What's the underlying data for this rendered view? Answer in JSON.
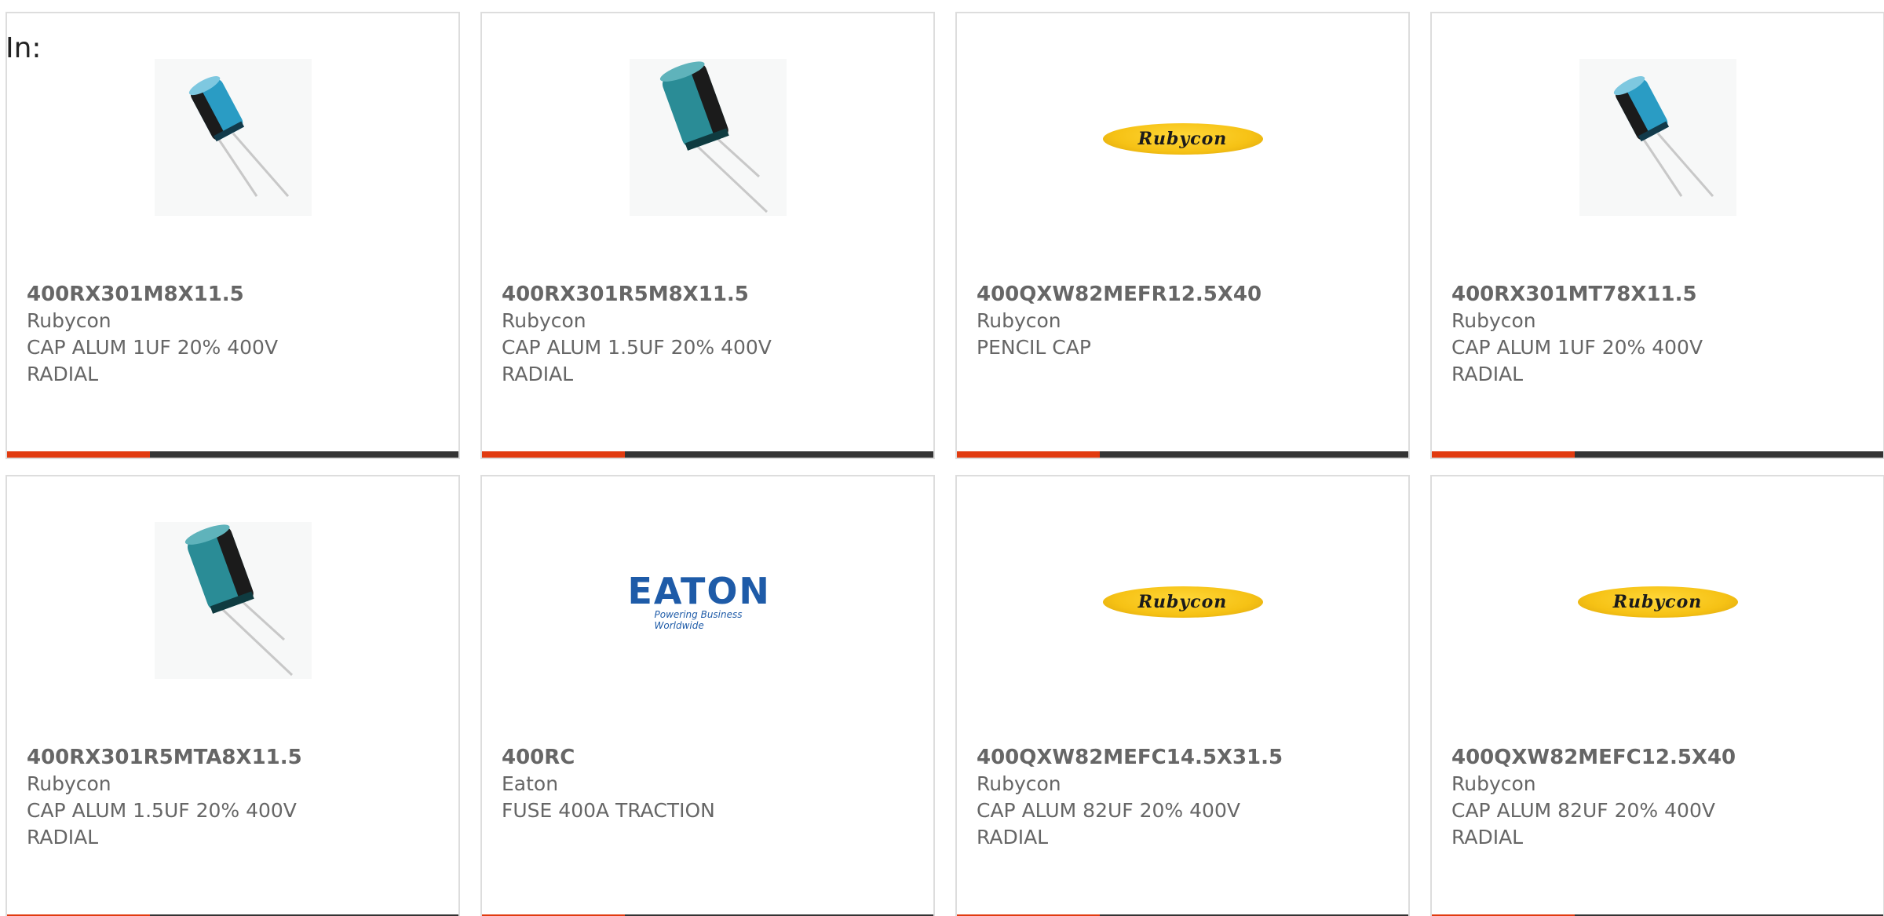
{
  "filter_label": "In:",
  "products": [
    {
      "part_number": "400RX301M8X11.5",
      "manufacturer": "Rubycon",
      "description": "CAP ALUM 1UF 20% 400V RADIAL",
      "image": "capacitor-small-icon"
    },
    {
      "part_number": "400RX301R5M8X11.5",
      "manufacturer": "Rubycon",
      "description": "CAP ALUM 1.5UF 20% 400V RADIAL",
      "image": "capacitor-large-icon"
    },
    {
      "part_number": "400QXW82MEFR12.5X40",
      "manufacturer": "Rubycon",
      "description": "PENCIL CAP",
      "image": "rubycon-logo",
      "logo_text": "Rubycon"
    },
    {
      "part_number": "400RX301MT78X11.5",
      "manufacturer": "Rubycon",
      "description": "CAP ALUM 1UF 20% 400V RADIAL",
      "image": "capacitor-small-icon"
    },
    {
      "part_number": "400RX301R5MTA8X11.5",
      "manufacturer": "Rubycon",
      "description": "CAP ALUM 1.5UF 20% 400V RADIAL",
      "image": "capacitor-large-icon"
    },
    {
      "part_number": "400RC",
      "manufacturer": "Eaton",
      "description": "FUSE 400A TRACTION",
      "image": "eaton-logo",
      "logo_text": "EATON",
      "logo_tagline": "Powering Business Worldwide"
    },
    {
      "part_number": "400QXW82MEFC14.5X31.5",
      "manufacturer": "Rubycon",
      "description": "CAP ALUM 82UF 20% 400V RADIAL",
      "image": "rubycon-logo",
      "logo_text": "Rubycon"
    },
    {
      "part_number": "400QXW82MEFC12.5X40",
      "manufacturer": "Rubycon",
      "description": "CAP ALUM 82UF 20% 400V RADIAL",
      "image": "rubycon-logo",
      "logo_text": "Rubycon"
    }
  ],
  "colors": {
    "accent_bar": "#e13b10",
    "dark_bar": "#333333",
    "card_border": "#dddddd",
    "text": "#666666",
    "rubycon_yellow": "#f6c215",
    "eaton_blue": "#1e5ba8"
  }
}
